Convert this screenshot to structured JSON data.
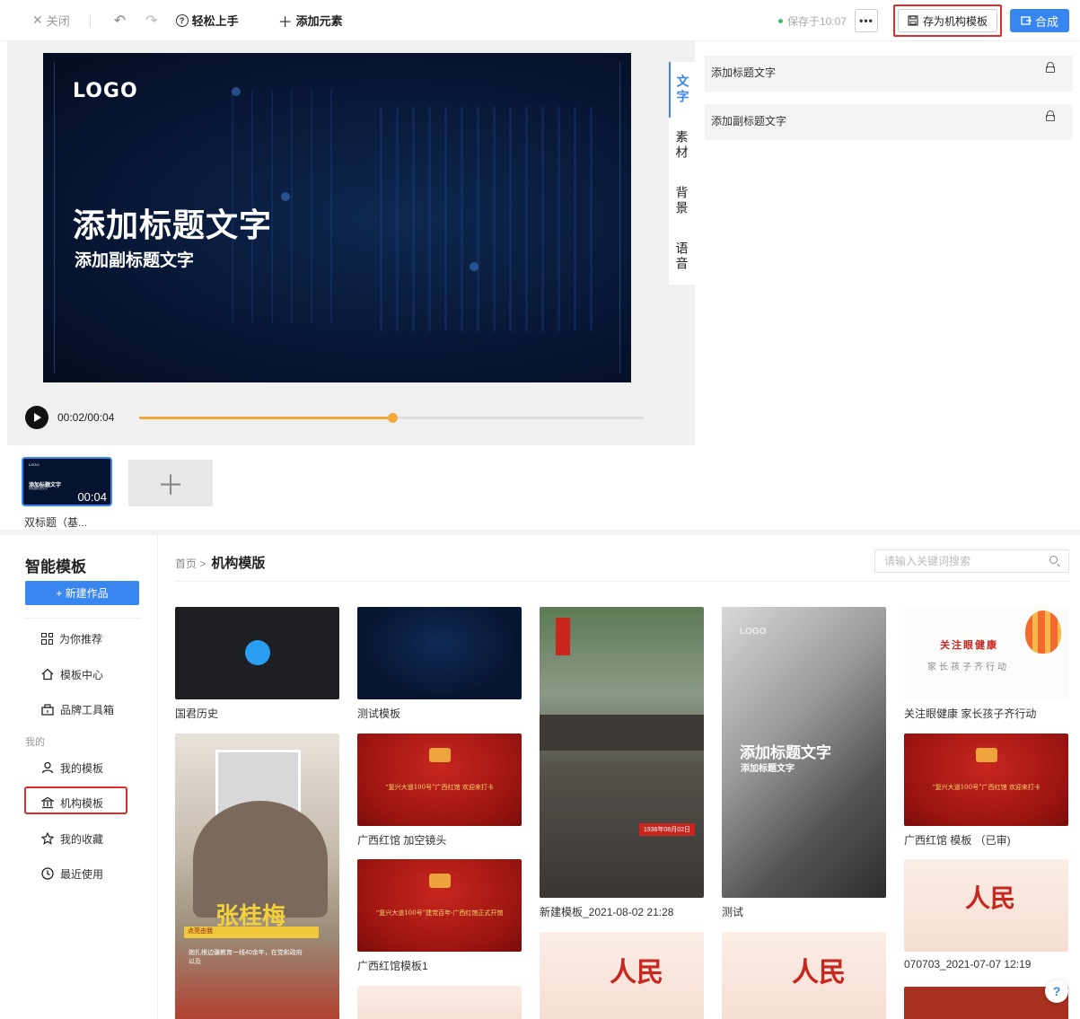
{
  "topbar": {
    "close_label": "关闭",
    "help_label": "轻松上手",
    "add_element_label": "添加元素",
    "save_status": "保存于10:07",
    "more_label": "•••",
    "save_template_label": "存为机构模板",
    "compose_label": "合成"
  },
  "canvas": {
    "logo": "LOGO",
    "title": "添加标题文字",
    "subtitle": "添加副标题文字"
  },
  "player": {
    "time": "00:02/00:04",
    "progress": 0.5
  },
  "side_tabs": [
    "文字",
    "素材",
    "背景",
    "语音"
  ],
  "text_props": [
    {
      "label": "添加标题文字"
    },
    {
      "label": "添加副标题文字"
    }
  ],
  "timeline": {
    "scene_duration": "00:04",
    "scene_label": "双标题（基...",
    "thumb_logo": "LOGO",
    "thumb_title": "添加标题文字",
    "thumb_sub": "添加副标题文字"
  },
  "sidebar": {
    "title": "智能模板",
    "new_button": "+ 新建作品",
    "items": [
      {
        "label": "为你推荐",
        "icon": "grid-icon"
      },
      {
        "label": "模板中心",
        "icon": "home-icon"
      },
      {
        "label": "品牌工具箱",
        "icon": "toolbox-icon"
      }
    ],
    "section_label": "我的",
    "my_items": [
      {
        "label": "我的模板",
        "icon": "user-icon"
      },
      {
        "label": "机构模板",
        "icon": "institution-icon"
      },
      {
        "label": "我的收藏",
        "icon": "star-icon"
      },
      {
        "label": "最近使用",
        "icon": "clock-icon"
      }
    ]
  },
  "content": {
    "breadcrumb_home": "首页 >",
    "breadcrumb_current": "机构模版",
    "search_placeholder": "请输入关键词搜索",
    "cards": [
      {
        "label": "国君历史"
      },
      {
        "label": "测试模板"
      },
      {
        "label": "新建模板_2021-08-02 21:28"
      },
      {
        "label": "测试"
      },
      {
        "label": "关注眼健康 家长孩子齐行动"
      },
      {
        "label": "广西红馆 加空镜头"
      },
      {
        "label": "广西红馆 模板 （已审)"
      },
      {
        "label": "广西红馆模板1"
      },
      {
        "label": "070703_2021-07-07 12:19"
      }
    ],
    "card_texts": {
      "eye_title": "关注眼健康",
      "eye_sub": "家长孩子齐行动",
      "red_line_1": "“复兴大道100号”广西红馆 欢迎来打卡",
      "red_line_2": "“复兴大道100号”建党百年·广西红馆正式开馆",
      "photo_date": "1936年08月02日",
      "type_title": "添加标题文字",
      "type_sub": "添加标题文字",
      "type_logo": "LOGO",
      "portrait_name": "张桂梅",
      "portrait_tag": "点亮由我",
      "portrait_caption": "她扎根边疆教育一线40余年，在党和政府以及",
      "renmin": "人民"
    }
  },
  "colors": {
    "accent": "#3a86f0",
    "highlight": "#e02b2b",
    "progress": "#f2a93b"
  }
}
